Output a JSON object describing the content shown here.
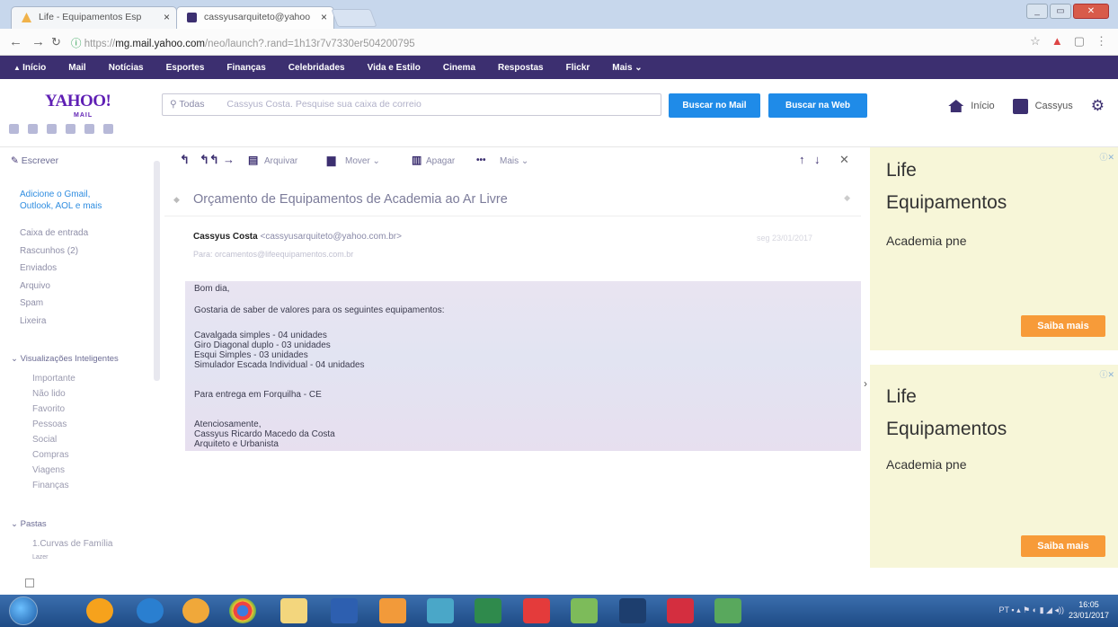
{
  "browser": {
    "tabs": [
      {
        "title": "Life - Equipamentos Esp",
        "close": "×",
        "icon": "yahoo-lycos-favicon"
      },
      {
        "title": "cassyusarquiteto@yahoo",
        "close": "×",
        "icon": "mail-favicon"
      }
    ],
    "url_prefix": "https://",
    "url_host": "mg.mail.yahoo.com",
    "url_path": "/neo/launch?.rand=1h13r7v7330er504200795"
  },
  "yahoo_nav": {
    "items": [
      "Início",
      "Mail",
      "Notícias",
      "Esportes",
      "Finanças",
      "Celebridades",
      "Vida e Estilo",
      "Cinema",
      "Respostas",
      "Flickr",
      "Mais ⌄"
    ]
  },
  "header": {
    "logo": "YAHOO!",
    "logo_sub": "MAIL",
    "search_scope": "Todas",
    "search_placeholder": "Cassyus Costa. Pesquise sua caixa de correio",
    "search_mail_btn": "Buscar no Mail",
    "search_web_btn": "Buscar na Web",
    "home_label": "Início",
    "user_name": "Cassyus"
  },
  "sidebar": {
    "compose": "Escrever",
    "add_accounts_1": "Adicione o Gmail,",
    "add_accounts_2": "Outlook, AOL e mais",
    "folders": [
      "Caixa de entrada",
      "Rascunhos (2)",
      "Enviados",
      "Arquivo",
      "Spam",
      "Lixeira"
    ],
    "smart_views_label": "Visualizações Inteligentes",
    "smart_views": [
      "Importante",
      "Não lido",
      "Favorito",
      "Pessoas",
      "Social",
      "Compras",
      "Viagens",
      "Finanças"
    ],
    "folders_label": "Pastas",
    "custom_folders": [
      "1.Curvas de Família",
      "Lazer"
    ]
  },
  "toolbar": {
    "archive": "Arquivar",
    "move": "Mover ⌄",
    "delete": "Apagar",
    "more": "Mais ⌄"
  },
  "message": {
    "subject": "Orçamento de Equipamentos de Academia ao Ar Livre",
    "sender_name": "Cassyus Costa",
    "sender_email": "<cassyusarquiteto@yahoo.com.br>",
    "recipient": "Para: orcamentos@lifeequipamentos.com.br",
    "date": "seg 23/01/2017",
    "body": [
      "Bom dia,",
      "Gostaria de saber de valores para os seguintes equipamentos:",
      "Cavalgada simples - 04 unidades",
      "Giro Diagonal duplo - 03 unidades",
      "Esqui Simples - 03 unidades",
      "Simulador Escada Individual - 04 unidades",
      "Para entrega em Forquilha - CE",
      "Atenciosamente,",
      "Cassyus Ricardo Macedo da Costa",
      "Arquiteto e Urbanista"
    ]
  },
  "ads": [
    {
      "title_1": "Life",
      "title_2": "Equipamentos",
      "subtitle": "Academia pne",
      "button": "Saiba mais",
      "badge": "ⓘ✕"
    },
    {
      "title_1": "Life",
      "title_2": "Equipamentos",
      "subtitle": "Academia pne",
      "button": "Saiba mais",
      "badge": "ⓘ✕"
    }
  ],
  "taskbar": {
    "lang": "PT",
    "time": "16:05",
    "date": "23/01/2017"
  },
  "colors": {
    "yahoo_purple": "#3c2f70",
    "search_button_blue": "#1f8be8",
    "ad_button_orange": "#f79b39"
  }
}
